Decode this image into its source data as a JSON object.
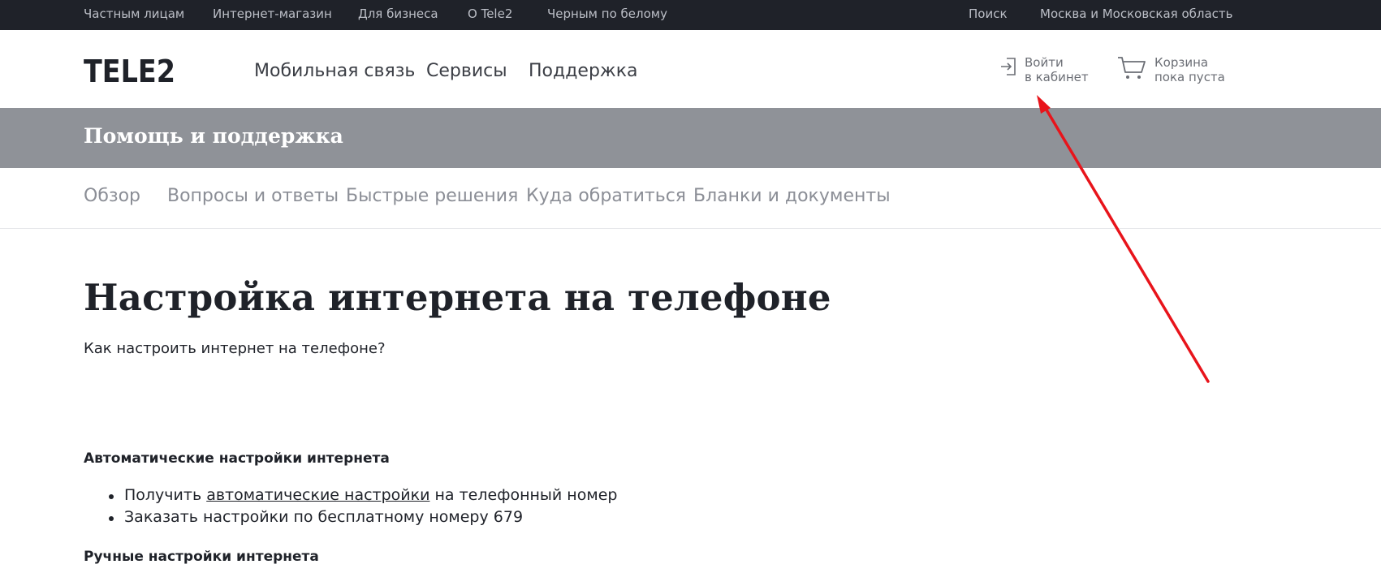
{
  "topbar": {
    "items": [
      "Частным лицам",
      "Интернет-магазин",
      "Для бизнеса",
      "О Tele2",
      "Черным по белому"
    ],
    "search": "Поиск",
    "region": "Москва и Московская область"
  },
  "header": {
    "logo_text": "TELE2",
    "nav": [
      "Мобильная связь",
      "Сервисы",
      "Поддержка"
    ],
    "login": {
      "line1": "Войти",
      "line2": "в кабинет",
      "icon": "login-icon"
    },
    "cart": {
      "line1": "Корзина",
      "line2": "пока пуста",
      "icon": "cart-icon"
    }
  },
  "band": {
    "title": "Помощь и поддержка"
  },
  "subnav": [
    "Обзор",
    "Вопросы и ответы",
    "Быстрые решения",
    "Куда обратиться",
    "Бланки и документы"
  ],
  "content": {
    "title": "Настройка интернета на телефоне",
    "lead": "Как настроить интернет на телефоне?",
    "auto_heading": "Автоматические настройки интернета",
    "auto_items": [
      {
        "before": "Получить ",
        "link": "автоматические настройки",
        "after": " на телефонный номер"
      },
      {
        "text": "Заказать настройки по бесплатному номеру 679"
      }
    ],
    "manual_heading": "Ручные настройки интернета"
  },
  "colors": {
    "topbar_bg": "#1f2229",
    "band_bg": "#8f9298",
    "annotation": "#e8141b"
  }
}
